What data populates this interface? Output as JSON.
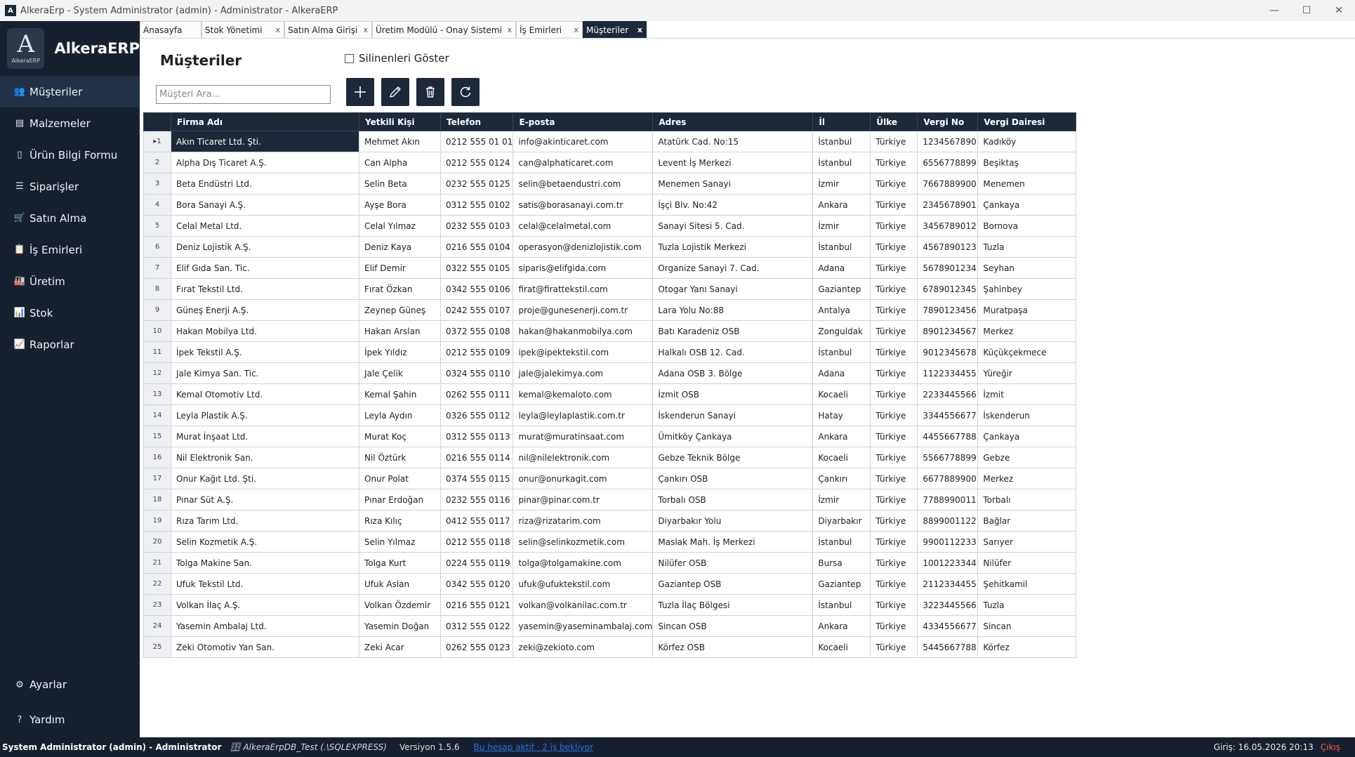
{
  "window": {
    "title": "AlkeraErp - System Administrator (admin) - Administrator - AlkeraERP",
    "icon_letter": "A",
    "minimize_glyph": "—",
    "maximize_glyph": "☐",
    "close_glyph": "✕"
  },
  "sidebar": {
    "logo_letter": "A",
    "logo_sub": "AlkeraERP",
    "brand": "AlkeraERP",
    "items": [
      {
        "label": "Müşteriler",
        "icon": "users-icon",
        "glyph": "👥"
      },
      {
        "label": "Malzemeler",
        "icon": "boxes-icon",
        "glyph": "▤"
      },
      {
        "label": "Ürün Bilgi Formu",
        "icon": "form-icon",
        "glyph": "▯"
      },
      {
        "label": "Siparişler",
        "icon": "orders-icon",
        "glyph": "☰"
      },
      {
        "label": "Satın Alma",
        "icon": "cart-icon",
        "glyph": "🛒"
      },
      {
        "label": "İş Emirleri",
        "icon": "work-order-icon",
        "glyph": "📋"
      },
      {
        "label": "Üretim",
        "icon": "factory-icon",
        "glyph": "🏭"
      },
      {
        "label": "Stok",
        "icon": "stock-chart-icon",
        "glyph": "📊"
      },
      {
        "label": "Raporlar",
        "icon": "report-icon",
        "glyph": "📈"
      }
    ],
    "bottom_items": [
      {
        "label": "Ayarlar",
        "icon": "gear-icon",
        "glyph": "⚙"
      },
      {
        "label": "Yardım",
        "icon": "help-icon",
        "glyph": "?"
      }
    ]
  },
  "tabs": [
    {
      "label": "Anasayfa",
      "closable": false
    },
    {
      "label": "Stok Yönetimi",
      "closable": true
    },
    {
      "label": "Satın Alma Girişi",
      "closable": true
    },
    {
      "label": "Üretim Modülü - Onay Sistemi",
      "closable": true
    },
    {
      "label": "İş Emirleri",
      "closable": true
    },
    {
      "label": "Müşteriler",
      "closable": true,
      "active": true
    }
  ],
  "tab_close_glyph": "x",
  "page": {
    "title": "Müşteriler",
    "show_deleted_label": "Silinenleri Göster",
    "search_placeholder": "Müşteri Ara..."
  },
  "toolbar": [
    {
      "name": "add-button",
      "icon": "plus-icon"
    },
    {
      "name": "edit-button",
      "icon": "pencil-icon"
    },
    {
      "name": "delete-button",
      "icon": "trash-icon"
    },
    {
      "name": "refresh-button",
      "icon": "refresh-icon"
    }
  ],
  "grid": {
    "columns": [
      "Firma Adı",
      "Yetkili Kişi",
      "Telefon",
      "E-posta",
      "Adres",
      "İl",
      "Ülke",
      "Vergi No",
      "Vergi Dairesi"
    ],
    "current_row_marker": "▸",
    "rows": [
      [
        "1",
        "Akın Ticaret Ltd. Şti.",
        "Mehmet Akın",
        "0212 555 01 01",
        "info@akinticaret.com",
        "Atatürk Cad. No:15",
        "İstanbul",
        "Türkiye",
        "1234567890",
        "Kadıköy"
      ],
      [
        "2",
        "Alpha Dış Ticaret A.Ş.",
        "Can Alpha",
        "0212 555 0124",
        "can@alphaticaret.com",
        "Levent İş Merkezi",
        "İstanbul",
        "Türkiye",
        "6556778899",
        "Beşiktaş"
      ],
      [
        "3",
        "Beta Endüstri Ltd.",
        "Selin Beta",
        "0232 555 0125",
        "selin@betaendustri.com",
        "Menemen Sanayi",
        "İzmir",
        "Türkiye",
        "7667889900",
        "Menemen"
      ],
      [
        "4",
        "Bora Sanayi A.Ş.",
        "Ayşe Bora",
        "0312 555 0102",
        "satis@borasanayi.com.tr",
        "İşçi Blv. No:42",
        "Ankara",
        "Türkiye",
        "2345678901",
        "Çankaya"
      ],
      [
        "5",
        "Celal Metal Ltd.",
        "Celal Yılmaz",
        "0232 555 0103",
        "celal@celalmetal.com",
        "Sanayi Sitesi 5. Cad.",
        "İzmir",
        "Türkiye",
        "3456789012",
        "Bornova"
      ],
      [
        "6",
        "Deniz Lojistik A.Ş.",
        "Deniz Kaya",
        "0216 555 0104",
        "operasyon@denizlojistik.com",
        "Tuzla Lojistik Merkezi",
        "İstanbul",
        "Türkiye",
        "4567890123",
        "Tuzla"
      ],
      [
        "7",
        "Elif Gıda San. Tic.",
        "Elif Demir",
        "0322 555 0105",
        "siparis@elifgida.com",
        "Organize Sanayi 7. Cad.",
        "Adana",
        "Türkiye",
        "5678901234",
        "Seyhan"
      ],
      [
        "8",
        "Fırat Tekstil Ltd.",
        "Fırat Özkan",
        "0342 555 0106",
        "firat@firattekstil.com",
        "Otogar Yanı Sanayi",
        "Gaziantep",
        "Türkiye",
        "6789012345",
        "Şahinbey"
      ],
      [
        "9",
        "Güneş Enerji A.Ş.",
        "Zeynep Güneş",
        "0242 555 0107",
        "proje@gunesenerji.com.tr",
        "Lara Yolu No:88",
        "Antalya",
        "Türkiye",
        "7890123456",
        "Muratpaşa"
      ],
      [
        "10",
        "Hakan Mobilya Ltd.",
        "Hakan Arslan",
        "0372 555 0108",
        "hakan@hakanmobilya.com",
        "Batı Karadeniz OSB",
        "Zonguldak",
        "Türkiye",
        "8901234567",
        "Merkez"
      ],
      [
        "11",
        "İpek Tekstil A.Ş.",
        "İpek Yıldız",
        "0212 555 0109",
        "ipek@ipektekstil.com",
        "Halkalı OSB 12. Cad.",
        "İstanbul",
        "Türkiye",
        "9012345678",
        "Küçükçekmece"
      ],
      [
        "12",
        "Jale Kimya San. Tic.",
        "Jale Çelik",
        "0324 555 0110",
        "jale@jalekimya.com",
        "Adana OSB 3. Bölge",
        "Adana",
        "Türkiye",
        "1122334455",
        "Yüreğir"
      ],
      [
        "13",
        "Kemal Otomotiv Ltd.",
        "Kemal Şahin",
        "0262 555 0111",
        "kemal@kemaloto.com",
        "İzmit OSB",
        "Kocaeli",
        "Türkiye",
        "2233445566",
        "İzmit"
      ],
      [
        "14",
        "Leyla Plastik A.Ş.",
        "Leyla Aydın",
        "0326 555 0112",
        "leyla@leylaplastik.com.tr",
        "İskenderun Sanayi",
        "Hatay",
        "Türkiye",
        "3344556677",
        "İskenderun"
      ],
      [
        "15",
        "Murat İnşaat Ltd.",
        "Murat Koç",
        "0312 555 0113",
        "murat@muratinsaat.com",
        "Ümitköy Çankaya",
        "Ankara",
        "Türkiye",
        "4455667788",
        "Çankaya"
      ],
      [
        "16",
        "Nil Elektronik San.",
        "Nil Öztürk",
        "0216 555 0114",
        "nil@nilelektronik.com",
        "Gebze Teknik Bölge",
        "Kocaeli",
        "Türkiye",
        "5566778899",
        "Gebze"
      ],
      [
        "17",
        "Onur Kağıt Ltd. Şti.",
        "Onur Polat",
        "0374 555 0115",
        "onur@onurkagit.com",
        "Çankırı OSB",
        "Çankırı",
        "Türkiye",
        "6677889900",
        "Merkez"
      ],
      [
        "18",
        "Pınar Süt A.Ş.",
        "Pınar Erdoğan",
        "0232 555 0116",
        "pinar@pinar.com.tr",
        "Torbalı OSB",
        "İzmir",
        "Türkiye",
        "7788990011",
        "Torbalı"
      ],
      [
        "19",
        "Rıza Tarım Ltd.",
        "Rıza Kılıç",
        "0412 555 0117",
        "riza@rizatarim.com",
        "Diyarbakır Yolu",
        "Diyarbakır",
        "Türkiye",
        "8899001122",
        "Bağlar"
      ],
      [
        "20",
        "Selin Kozmetik A.Ş.",
        "Selin Yılmaz",
        "0212 555 0118",
        "selin@selinkozmetik.com",
        "Maslak Mah. İş Merkezi",
        "İstanbul",
        "Türkiye",
        "9900112233",
        "Sarıyer"
      ],
      [
        "21",
        "Tolga Makine San.",
        "Tolga Kurt",
        "0224 555 0119",
        "tolga@tolgamakine.com",
        "Nilüfer OSB",
        "Bursa",
        "Türkiye",
        "1001223344",
        "Nilüfer"
      ],
      [
        "22",
        "Ufuk Tekstil Ltd.",
        "Ufuk Aslan",
        "0342 555 0120",
        "ufuk@ufuktekstil.com",
        "Gaziantep OSB",
        "Gaziantep",
        "Türkiye",
        "2112334455",
        "Şehitkamil"
      ],
      [
        "23",
        "Volkan İlaç A.Ş.",
        "Volkan Özdemir",
        "0216 555 0121",
        "volkan@volkanilac.com.tr",
        "Tuzla İlaç Bölgesi",
        "İstanbul",
        "Türkiye",
        "3223445566",
        "Tuzla"
      ],
      [
        "24",
        "Yasemin Ambalaj Ltd.",
        "Yasemin Doğan",
        "0312 555 0122",
        "yasemin@yaseminambalaj.com",
        "Sincan OSB",
        "Ankara",
        "Türkiye",
        "4334556677",
        "Sincan"
      ],
      [
        "25",
        "Zeki Otomotiv Yan San.",
        "Zeki Acar",
        "0262 555 0123",
        "zeki@zekioto.com",
        "Körfez OSB",
        "Kocaeli",
        "Türkiye",
        "5445667788",
        "Körfez"
      ]
    ]
  },
  "statusbar": {
    "user": "System Administrator (admin) - Administrator",
    "db": "🗄 AlkeraErpDB_Test (.\\SQLEXPRESS)",
    "version": "Versiyon 1.5.6",
    "link": "Bu hesap aktif · 2 iş bekliyor",
    "login_time": "Giriş: 16.05.2026 20:13",
    "exit": "Çıkış"
  },
  "colors": {
    "sidebar_bg": "#17202e",
    "accent_dark": "#1d2939",
    "exit_red": "#ff5252",
    "link_blue": "#2a6ee6"
  }
}
